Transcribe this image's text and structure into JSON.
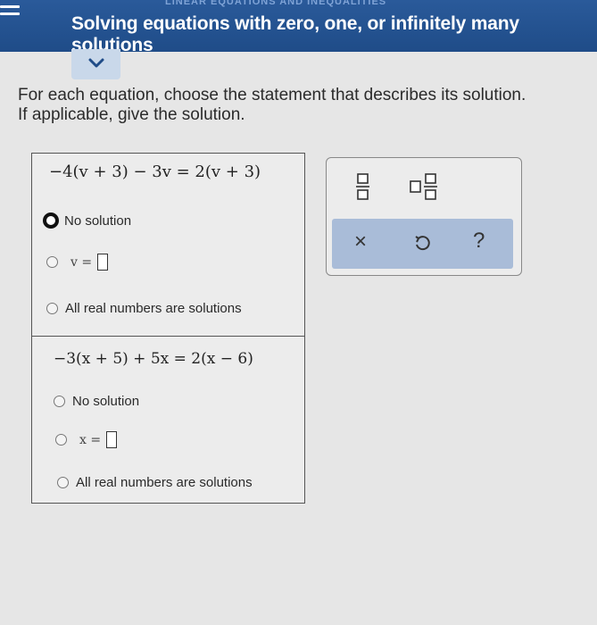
{
  "header": {
    "title": "Solving equations with zero, one, or infinitely many solutions",
    "subtitle_fragment": "LINEAR EQUATIONS AND INEQUALITIES"
  },
  "instructions": {
    "line1": "For each equation, choose the statement that describes its solution.",
    "line2": "If applicable, give the solution."
  },
  "problems": [
    {
      "equation": "−4(v + 3) − 3v = 2(v + 3)",
      "options": [
        "No solution",
        "v =",
        "All real numbers are solutions"
      ],
      "selected": "No solution",
      "answer_value": ""
    },
    {
      "equation": "−3(x + 5) + 5x = 2(x − 6)",
      "options": [
        "No solution",
        "x =",
        "All real numbers are solutions"
      ],
      "selected": "",
      "answer_value": ""
    }
  ],
  "palette": {
    "tools": [
      "fraction-icon",
      "mixed-number-icon"
    ],
    "actions": [
      "×",
      "undo-icon",
      "?"
    ]
  },
  "colors": {
    "header_bg": "#1f4c88",
    "chevron_tab": "#c9d8ea",
    "action_bar": "#a9bcd8"
  }
}
